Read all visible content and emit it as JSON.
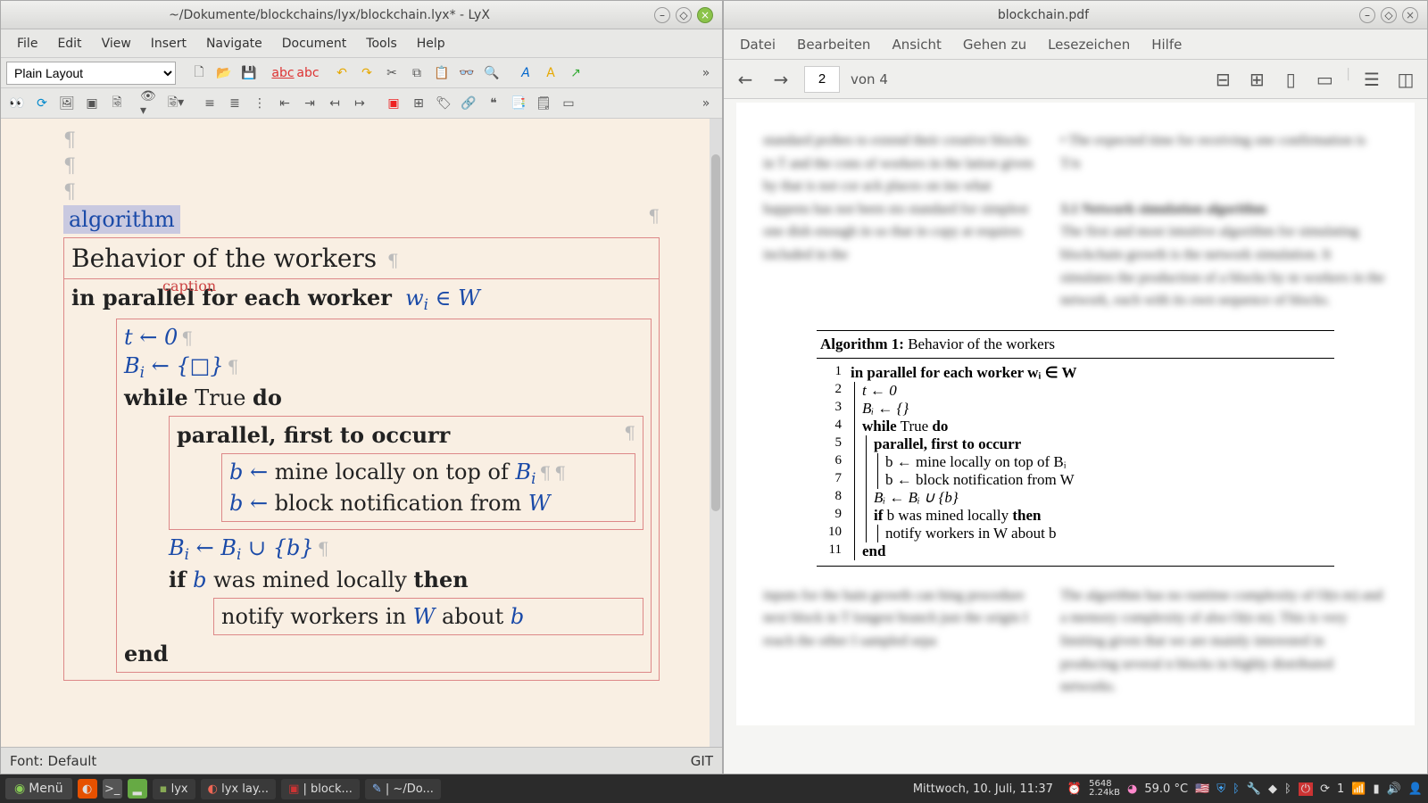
{
  "lyx": {
    "title": "~/Dokumente/blockchains/lyx/blockchain.lyx* - LyX",
    "menus": [
      "File",
      "Edit",
      "View",
      "Insert",
      "Navigate",
      "Document",
      "Tools",
      "Help"
    ],
    "layout_selector": "Plain Layout",
    "status_left": "Font: Default",
    "status_right": "GIT",
    "env_label": "algorithm",
    "caption_text": "Behavior of the workers",
    "caption_label": "caption",
    "alg_parallel_kw": "in parallel for each worker",
    "alg_w_in_W": "w",
    "alg_in": " ∈ ",
    "alg_W": "W",
    "t_assign": "t ← 0",
    "Bi_assign": "B",
    "Bi_assign2": " ← {□}",
    "while_kw": "while",
    "while_cond": " True ",
    "do_kw": "do",
    "parallel_first": "parallel, first to occurr",
    "mine1_pre": "b ← ",
    "mine1": "mine locally on top of ",
    "mine1_B": "B",
    "mine2_pre": "b ← ",
    "mine2": "block notification from ",
    "mine2_W": "W",
    "union_line_B1": "B",
    "union_line_mid": " ← ",
    "union_line_B2": "B",
    "union_line_end": " ∪ {b}",
    "if_kw": "if",
    "if_cond_pre": " ",
    "if_var": "b",
    "if_cond": " was mined locally ",
    "then_kw": "then",
    "notify": "notify workers in ",
    "notify_W": "W",
    "notify_end": " about ",
    "notify_b": "b",
    "end_kw": "end"
  },
  "pdf": {
    "title": "blockchain.pdf",
    "menus": [
      "Datei",
      "Bearbeiten",
      "Ansicht",
      "Gehen zu",
      "Lesezeichen",
      "Hilfe"
    ],
    "page_input": "2",
    "page_count": "von 4",
    "alg_title_pre": "Algorithm 1:",
    "alg_title": " Behavior of the workers",
    "lines": [
      {
        "n": "1",
        "txt": "in parallel for each worker  wᵢ ∈ W",
        "bold": true,
        "indent": 0,
        "bars": 0
      },
      {
        "n": "2",
        "txt": "t ← 0",
        "indent": 1,
        "bars": 1,
        "italic": true
      },
      {
        "n": "3",
        "txt": "Bᵢ ← {}",
        "indent": 1,
        "bars": 1,
        "italic": true
      },
      {
        "n": "4",
        "txt": "while True do",
        "indent": 1,
        "bars": 1,
        "boldpart": true
      },
      {
        "n": "5",
        "txt": "parallel, first to occurr",
        "indent": 2,
        "bars": 2,
        "bold": true
      },
      {
        "n": "6",
        "txt": "b ← mine locally on top of Bᵢ",
        "indent": 3,
        "bars": 3
      },
      {
        "n": "7",
        "txt": "b ← block notification from W",
        "indent": 3,
        "bars": 3
      },
      {
        "n": "8",
        "txt": "Bᵢ ← Bᵢ ∪ {b}",
        "indent": 2,
        "bars": 2,
        "italic": true
      },
      {
        "n": "9",
        "txt": "if b was mined locally then",
        "indent": 2,
        "bars": 2,
        "boldpart": true
      },
      {
        "n": "10",
        "txt": "notify workers in W about b",
        "indent": 3,
        "bars": 3
      },
      {
        "n": "11",
        "txt": "end",
        "indent": 1,
        "bars": 1,
        "bold": true
      }
    ]
  },
  "taskbar": {
    "menu": "Menü",
    "tasks": [
      "lyx",
      "lyx lay...",
      "| block...",
      "| ~/Do..."
    ],
    "clock": "Mittwoch, 10. Juli, 11:37",
    "temp": "59.0 °C",
    "net_down": "5648",
    "net_up": "2.24kB"
  }
}
